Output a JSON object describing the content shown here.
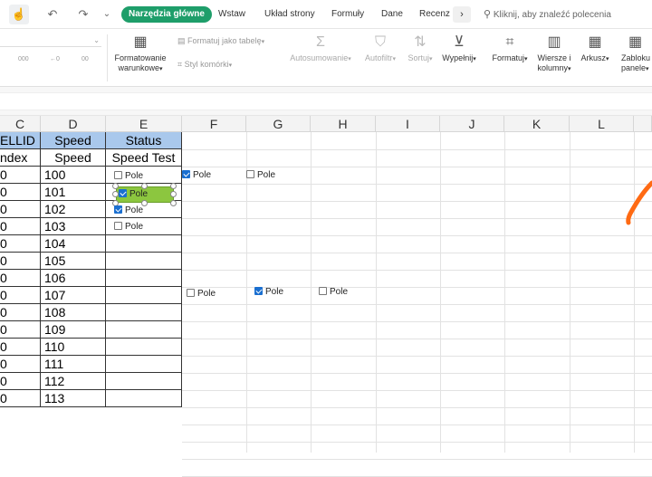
{
  "toolbar": {
    "quick_access": [
      "☝",
      "↶",
      "↷",
      "⌄"
    ],
    "tabs": [
      "Narzędzia główne",
      "Wstaw",
      "Układ strony",
      "Formuły",
      "Dane",
      "Recenz"
    ],
    "more": "›",
    "search_placeholder": "Kliknij, aby znaleźć polecenia"
  },
  "ribbon": {
    "formatowanie": "Formatowanie",
    "warunkowe": "warunkowe",
    "formatuj_tabele": "Formatuj jako tabelę",
    "styl_komorki": "Styl komórki",
    "autosumowanie": "Autosumowanie",
    "autofiltr": "Autofiltr",
    "sortuj": "Sortuj",
    "wypelnij": "Wypełnij",
    "formatuj": "Formatuj",
    "wiersze": "Wiersze i",
    "kolumny": "kolumny",
    "arkusz": "Arkusz",
    "zablokuj": "Zabloku",
    "panele": "panele",
    "num_format_labels": [
      "000",
      "←0",
      "00"
    ]
  },
  "grid": {
    "columns": [
      "C",
      "D",
      "E",
      "F",
      "G",
      "H",
      "I",
      "J",
      "K",
      "L"
    ],
    "header_row1": {
      "c": "ELLID",
      "d": "Speed",
      "e": "Status"
    },
    "header_row2": {
      "c": "ndex",
      "d": "Speed",
      "e": "Speed Test"
    },
    "c_values": [
      "0",
      "0",
      "0",
      "0",
      "0",
      "0",
      "0",
      "0",
      "0",
      "0",
      "0",
      "0",
      "0",
      "0"
    ],
    "d_values": [
      "100",
      "101",
      "102",
      "103",
      "104",
      "105",
      "106",
      "107",
      "108",
      "109",
      "110",
      "111",
      "112",
      "113"
    ]
  },
  "checkboxes": {
    "label": "Pole",
    "e1": false,
    "e2": true,
    "e3": true,
    "e4": false,
    "f1": true,
    "g1": false,
    "f8": false,
    "g8": true,
    "h8": false
  },
  "colors": {
    "accent": "#1e9e6a",
    "header_fill": "#a9c8ec",
    "selected_checkbox": "#8cc63f",
    "checkbox_on": "#1a6fd0",
    "arrow": "#ff6a13"
  }
}
